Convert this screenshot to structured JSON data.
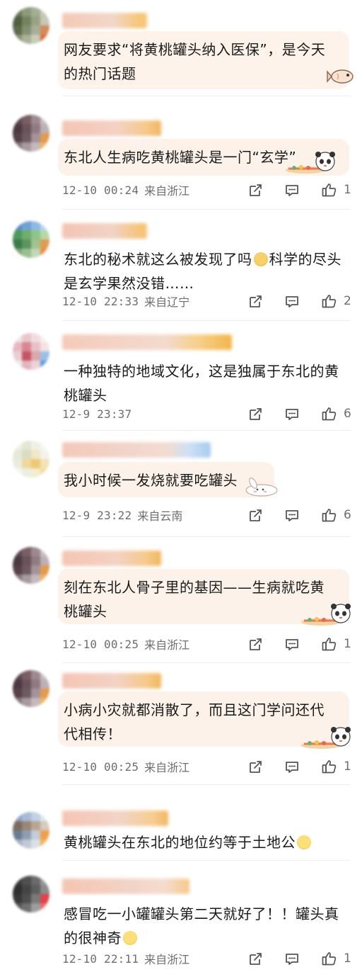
{
  "comments": [
    {
      "text": "网友要求“将黄桃罐头纳入医保”，是今天的热门话题",
      "line1": "网友要求“将黄桃罐头纳入医保”，是今天",
      "line2": "的热门话题",
      "time": "",
      "location": "",
      "likes": "",
      "sticker": "fish-sticker"
    },
    {
      "line1": "东北人生病吃黄桃罐头是一门“玄学”",
      "line2": "",
      "time": "12-10 00:24",
      "location": "来自浙江",
      "likes": "1",
      "sticker": "panda-sticker"
    },
    {
      "line1": "东北的秘术就这么被发现了吗",
      "line1_after": "科学的尽头",
      "line2": "是玄学果然没错……",
      "emoji": "dog-emoji",
      "time": "12-10 22:33",
      "location": "来自辽宁",
      "likes": "2"
    },
    {
      "line1": "一种独特的地域文化，这是独属于东北的黄",
      "line2": "桃罐头",
      "time": "12-9 23:37",
      "location": "",
      "likes": "6"
    },
    {
      "line1": "我小时候一发烧就要吃罐头",
      "line2": "",
      "time": "12-9 23:22",
      "location": "来自云南",
      "likes": "6",
      "sticker": "rabbit-sticker"
    },
    {
      "line1": "刻在东北人骨子里的基因——生病就吃黄",
      "line2": "桃罐头",
      "time": "12-10 00:25",
      "location": "来自浙江",
      "likes": "1",
      "sticker": "panda-sticker"
    },
    {
      "line1": "小病小灾就都消散了，而且这门学问还代",
      "line2": "代相传！",
      "time": "12-10 00:25",
      "location": "来自浙江",
      "likes": "1",
      "sticker": "panda-sticker"
    },
    {
      "line1": "黄桃罐头在东北的地位约等于土地公",
      "line2": "",
      "emoji": "smile-emoji",
      "time": "",
      "location": "",
      "likes": ""
    },
    {
      "line1": "感冒吃一小罐罐头第二天就好了！！罐头真",
      "line2": "的很神奇",
      "emoji": "cry-emoji",
      "time": "12-10 22:11",
      "location": "来自浙江",
      "likes": "1"
    }
  ],
  "icons": {
    "repost": "repost-icon",
    "comment": "comment-icon",
    "like": "thumbs-up-icon"
  },
  "colors": {
    "bubble": "#fdf2e9",
    "meta_text": "#6e6e6e",
    "divider": "#eeeeee"
  }
}
